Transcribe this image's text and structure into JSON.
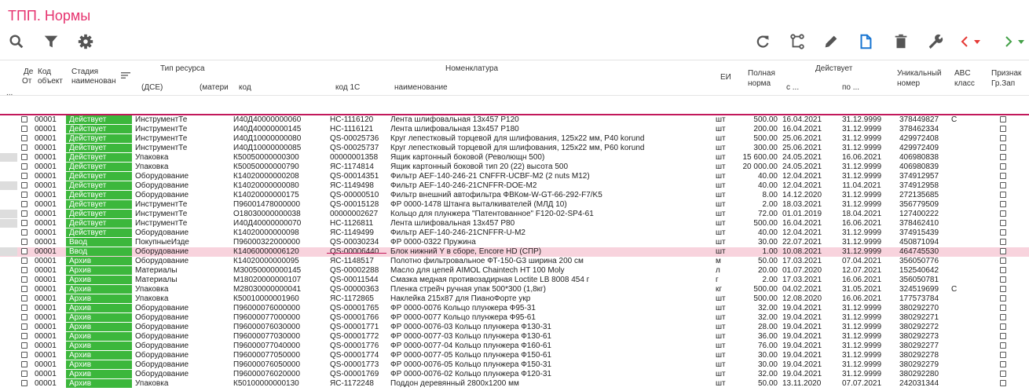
{
  "app": {
    "title": "ТПП. Нормы"
  },
  "toolbar": {
    "left": [
      "search-icon",
      "filter-icon",
      "gear-icon"
    ],
    "right": [
      "refresh-icon",
      "tree-icon",
      "edit-icon",
      "document-icon",
      "delete-icon",
      "wrench-icon",
      "nav-left-icon",
      "nav-right-icon"
    ],
    "colors": {
      "icon": "#555555",
      "document": "#1976d2",
      "prev": "#e53935",
      "next": "#43a047"
    }
  },
  "header": {
    "de": "Де",
    "ot": "От",
    "code": "Код",
    "object": "объект",
    "stage": "Стадия",
    "stage_name": "наименован",
    "res_type": "Тип ресурса",
    "dse": "(ДСЕ)",
    "materi": "(матери",
    "nomen": "Номенклатура",
    "kod": "код",
    "kod1c": "код 1С",
    "naim": "наименование",
    "ei": "ЕИ",
    "full": "Полная",
    "norma": "норма",
    "acts": "Действует",
    "from": "с ...",
    "to": "по ...",
    "uniq": "Уникальный",
    "num": "номер",
    "abc": "ABC",
    "klass": "класс",
    "priz": "Признак",
    "grzap": "Гр.Зап",
    "dots": "..."
  },
  "status_colors": {
    "active": "#3cb73c",
    "intro": "#3cb73c",
    "archive": "#3cb73c"
  },
  "rows": [
    {
      "m": 0,
      "obj": "00001",
      "st": "Действует",
      "tip": "ИнструментТе",
      "code": "И40Д40000000060",
      "c1": "НС-1116120",
      "name": "Лента шлифовальная 13х457 P120",
      "ei": "шт",
      "qty": "500.00",
      "from": "16.04.2021",
      "to": "31.12.9999",
      "uid": "378449827",
      "abc": "C"
    },
    {
      "m": 0,
      "obj": "00001",
      "st": "Действует",
      "tip": "ИнструментТе",
      "code": "И40Д40000000145",
      "c1": "НС-1116121",
      "name": "Лента шлифовальная 13х457 P180",
      "ei": "шт",
      "qty": "200.00",
      "from": "16.04.2021",
      "to": "31.12.9999",
      "uid": "378462334",
      "abc": ""
    },
    {
      "m": 0,
      "obj": "00001",
      "st": "Действует",
      "tip": "ИнструментТе",
      "code": "И40Д10000000080",
      "c1": "QS-00025736",
      "name": "Круг лепестковый торцевой для шлифования, 125х22 мм, P40 korund",
      "ei": "шт",
      "qty": "500.00",
      "from": "25.06.2021",
      "to": "31.12.9999",
      "uid": "429972408",
      "abc": ""
    },
    {
      "m": 0,
      "obj": "00001",
      "st": "Действует",
      "tip": "ИнструментТе",
      "code": "И40Д10000000085",
      "c1": "QS-00025737",
      "name": "Круг лепестковый торцевой для шлифования, 125х22 мм, P60 korund",
      "ei": "шт",
      "qty": "300.00",
      "from": "25.06.2021",
      "to": "31.12.9999",
      "uid": "429972409",
      "abc": ""
    },
    {
      "m": 1,
      "obj": "00001",
      "st": "Действует",
      "tip": "Упаковка",
      "code": "К50050000000300",
      "c1": "00000001358",
      "name": "Ящик картонный боковой (Револющн 500)",
      "ei": "шт",
      "qty": "15 600.00",
      "from": "24.05.2021",
      "to": "16.06.2021",
      "uid": "406980838",
      "abc": ""
    },
    {
      "m": 0,
      "obj": "00001",
      "st": "Действует",
      "tip": "Упаковка",
      "code": "К50050000000790",
      "c1": "ЯС-1174814",
      "name": "Ящик картонный боковой тип 20 (22) высота 500",
      "ei": "шт",
      "qty": "20 000.00",
      "from": "24.05.2021",
      "to": "31.12.9999",
      "uid": "406980839",
      "abc": ""
    },
    {
      "m": 0,
      "obj": "00001",
      "st": "Действует",
      "tip": "Оборудование",
      "code": "К14020000000208",
      "c1": "QS-00014351",
      "name": "Фильтр AEF-140-246-21 CNFFR-UCBF-M2 (2 nuts M12)",
      "ei": "шт",
      "qty": "40.00",
      "from": "12.04.2021",
      "to": "31.12.9999",
      "uid": "374912957",
      "abc": ""
    },
    {
      "m": 1,
      "obj": "00001",
      "st": "Действует",
      "tip": "Оборудование",
      "code": "К14020000000080",
      "c1": "ЯС-1149498",
      "name": "Фильтр AEF-140-246-21CNFFR-DOE-M2",
      "ei": "шт",
      "qty": "40.00",
      "from": "12.04.2021",
      "to": "11.04.2021",
      "uid": "374912958",
      "abc": ""
    },
    {
      "m": 0,
      "obj": "00001",
      "st": "Действует",
      "tip": "Оборудование",
      "code": "К14020000000175",
      "c1": "QS-00000510",
      "name": "Фильтр внешний автофильтра ФВКом-W-GT-66-292-F7/K5",
      "ei": "шт",
      "qty": "8.00",
      "from": "14.12.2020",
      "to": "31.12.9999",
      "uid": "272135685",
      "abc": ""
    },
    {
      "m": 0,
      "obj": "00001",
      "st": "Действует",
      "tip": "ИнструментТе",
      "code": "П96001478000000",
      "c1": "QS-00015128",
      "name": "ФР 0000-1478 Штанга выталкивателей (МЛД 10)",
      "ei": "шт",
      "qty": "2.00",
      "from": "18.03.2021",
      "to": "31.12.9999",
      "uid": "356779509",
      "abc": ""
    },
    {
      "m": 1,
      "obj": "00001",
      "st": "Действует",
      "tip": "ИнструментТе",
      "code": "О18030000000038",
      "c1": "00000002627",
      "name": "Кольцо для плунжера \"Патентованное\" F120-02-SP4-61",
      "ei": "шт",
      "qty": "72.00",
      "from": "01.01.2019",
      "to": "18.04.2021",
      "uid": "127400222",
      "abc": ""
    },
    {
      "m": 1,
      "obj": "00001",
      "st": "Действует",
      "tip": "ИнструментТе",
      "code": "И40Д40000000070",
      "c1": "НС-1126811",
      "name": "Лента шлифовальная 13х457 P80",
      "ei": "шт",
      "qty": "500.00",
      "from": "16.04.2021",
      "to": "16.06.2021",
      "uid": "378462410",
      "abc": ""
    },
    {
      "m": 0,
      "obj": "00001",
      "st": "Действует",
      "tip": "Оборудование",
      "code": "К14020000000098",
      "c1": "ЯС-1149499",
      "name": "Фильтр AEF-140-246-21CNFFR-U-M2",
      "ei": "шт",
      "qty": "40.00",
      "from": "12.04.2021",
      "to": "31.12.9999",
      "uid": "374915439",
      "abc": ""
    },
    {
      "m": 0,
      "obj": "00001",
      "st": "Ввод",
      "tip": "ПокупныеИзде",
      "code": "П96000322000000",
      "c1": "QS-00030234",
      "name": "ФР 0000-0322 Пружина",
      "ei": "шт",
      "qty": "30.00",
      "from": "22.07.2021",
      "to": "31.12.9999",
      "uid": "450871094",
      "abc": ""
    },
    {
      "m": 1,
      "obj": "00001",
      "st": "Ввод",
      "tip": "Оборудование",
      "code": "К14060000006120",
      "c1": "QS-00006440",
      "name": "Блок нижний Y в сборе, Encore HD (СПР)",
      "ei": "шт",
      "qty": "1.00",
      "from": "10.08.2021",
      "to": "31.12.9999",
      "uid": "464745530",
      "abc": "",
      "sel": 1
    },
    {
      "m": 0,
      "obj": "00001",
      "st": "Архив",
      "tip": "Оборудование",
      "code": "К14020000000095",
      "c1": "ЯС-1148517",
      "name": "Полотно фильтровальное ФТ-150-G3 ширина 200 см",
      "ei": "м",
      "qty": "50.00",
      "from": "17.03.2021",
      "to": "07.04.2021",
      "uid": "356050776",
      "abc": ""
    },
    {
      "m": 0,
      "obj": "00001",
      "st": "Архив",
      "tip": "Материалы",
      "code": "М30050000000145",
      "c1": "QS-00002288",
      "name": "Масло для цепей AIMOL Chaintech HT 100 Moly",
      "ei": "л",
      "qty": "20.00",
      "from": "01.07.2020",
      "to": "12.07.2021",
      "uid": "152540642",
      "abc": ""
    },
    {
      "m": 0,
      "obj": "00001",
      "st": "Архив",
      "tip": "Материалы",
      "code": "М18020000000107",
      "c1": "QS-00011544",
      "name": "Смазка медная противозадирная Loctite LB 8008 454 г",
      "ei": "г",
      "qty": "2.00",
      "from": "17.03.2021",
      "to": "16.06.2021",
      "uid": "356050781",
      "abc": ""
    },
    {
      "m": 0,
      "obj": "00001",
      "st": "Архив",
      "tip": "Упаковка",
      "code": "М28030000000041",
      "c1": "QS-00000363",
      "name": "Пленка стрейч ручная упак 500*300 (1,8кг)",
      "ei": "кг",
      "qty": "500.00",
      "from": "04.02.2021",
      "to": "31.05.2021",
      "uid": "324519699",
      "abc": "C"
    },
    {
      "m": 0,
      "obj": "00001",
      "st": "Архив",
      "tip": "Упаковка",
      "code": "К50010000001960",
      "c1": "ЯС-1172865",
      "name": "Наклейка 215х87 для ПианоФорте укр",
      "ei": "шт",
      "qty": "500.00",
      "from": "12.08.2020",
      "to": "16.06.2021",
      "uid": "177573784",
      "abc": ""
    },
    {
      "m": 0,
      "obj": "00001",
      "st": "Архив",
      "tip": "Оборудование",
      "code": "П96000076000000",
      "c1": "QS-00001765",
      "name": "ФР 0000-0076 Кольцо плунжера Ф95-31",
      "ei": "шт",
      "qty": "32.00",
      "from": "19.04.2021",
      "to": "31.12.9999",
      "uid": "380292270",
      "abc": ""
    },
    {
      "m": 0,
      "obj": "00001",
      "st": "Архив",
      "tip": "Оборудование",
      "code": "П96000077000000",
      "c1": "QS-00001766",
      "name": "ФР 0000-0077 Кольцо плунжера Ф95-61",
      "ei": "шт",
      "qty": "32.00",
      "from": "19.04.2021",
      "to": "31.12.9999",
      "uid": "380292271",
      "abc": ""
    },
    {
      "m": 0,
      "obj": "00001",
      "st": "Архив",
      "tip": "Оборудование",
      "code": "П96000076030000",
      "c1": "QS-00001771",
      "name": "ФР 0000-0076-03 Кольцо плунжера Ф130-31",
      "ei": "шт",
      "qty": "28.00",
      "from": "19.04.2021",
      "to": "31.12.9999",
      "uid": "380292272",
      "abc": ""
    },
    {
      "m": 0,
      "obj": "00001",
      "st": "Архив",
      "tip": "Оборудование",
      "code": "П96000077030000",
      "c1": "QS-00001772",
      "name": "ФР 0000-0077-03 Кольцо плунжера Ф130-61",
      "ei": "шт",
      "qty": "36.00",
      "from": "19.04.2021",
      "to": "31.12.9999",
      "uid": "380292273",
      "abc": ""
    },
    {
      "m": 0,
      "obj": "00001",
      "st": "Архив",
      "tip": "Оборудование",
      "code": "П96000077040000",
      "c1": "QS-00001776",
      "name": "ФР 0000-0077-04 Кольцо плунжера Ф160-61",
      "ei": "шт",
      "qty": "76.00",
      "from": "19.04.2021",
      "to": "31.12.9999",
      "uid": "380292277",
      "abc": ""
    },
    {
      "m": 0,
      "obj": "00001",
      "st": "Архив",
      "tip": "Оборудование",
      "code": "П96000077050000",
      "c1": "QS-00001774",
      "name": "ФР 0000-0077-05 Кольцо плунжера Ф150-61",
      "ei": "шт",
      "qty": "30.00",
      "from": "19.04.2021",
      "to": "31.12.9999",
      "uid": "380292278",
      "abc": ""
    },
    {
      "m": 0,
      "obj": "00001",
      "st": "Архив",
      "tip": "Оборудование",
      "code": "П96000076050000",
      "c1": "QS-00001773",
      "name": "ФР 0000-0076-05 Кольцо плунжера Ф150-31",
      "ei": "шт",
      "qty": "30.00",
      "from": "19.04.2021",
      "to": "31.12.9999",
      "uid": "380292279",
      "abc": ""
    },
    {
      "m": 0,
      "obj": "00001",
      "st": "Архив",
      "tip": "Оборудование",
      "code": "П96000076020000",
      "c1": "QS-00001769",
      "name": "ФР 0000-0076-02 Кольцо плунжера Ф120-31",
      "ei": "шт",
      "qty": "32.00",
      "from": "19.04.2021",
      "to": "31.12.9999",
      "uid": "380292280",
      "abc": ""
    },
    {
      "m": 0,
      "obj": "00001",
      "st": "Архив",
      "tip": "Упаковка",
      "code": "К50100000000130",
      "c1": "ЯС-1172248",
      "name": "Поддон деревянный 2800х1200 мм",
      "ei": "шт",
      "qty": "50.00",
      "from": "13.11.2020",
      "to": "07.07.2021",
      "uid": "242031344",
      "abc": ""
    }
  ]
}
